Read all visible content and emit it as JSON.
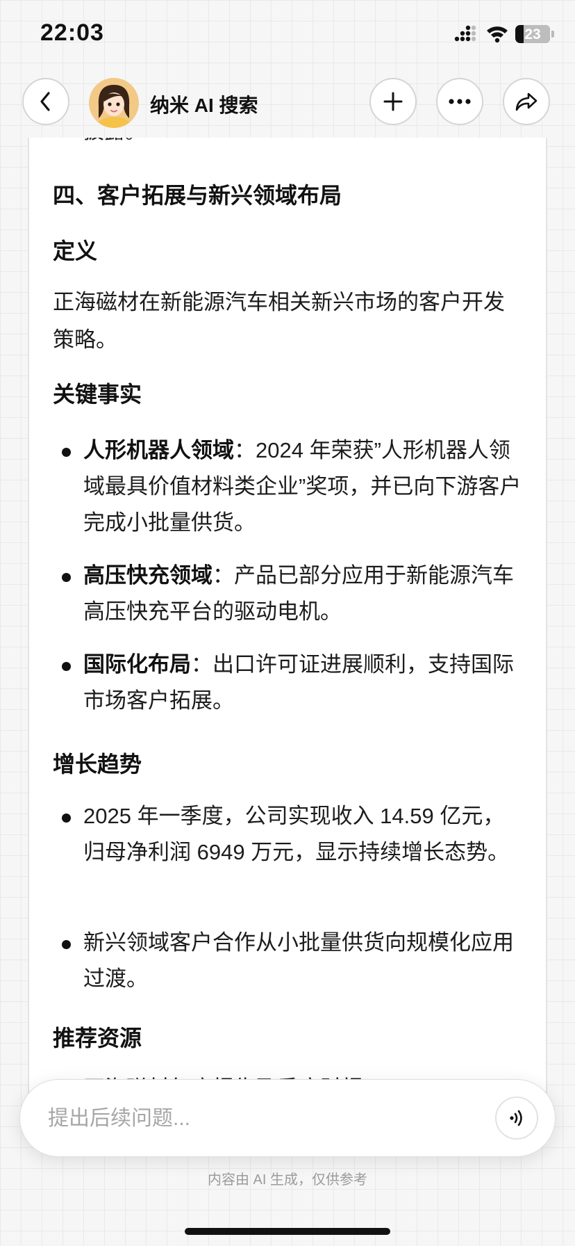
{
  "status_bar": {
    "time": "22:03",
    "battery_level": "23",
    "battery_fraction": 0.23
  },
  "header": {
    "agent_name": "纳米 AI 搜索",
    "back_icon": "chevron-left-icon",
    "new_icon": "plus-icon",
    "more_icon": "more-horizontal-icon",
    "share_icon": "share-icon"
  },
  "content": {
    "cut_text": "披露。",
    "section_title": "四、客户拓展与新兴领域布局",
    "definition_heading": "定义",
    "definition_text": "正海磁材在新能源汽车相关新兴市场的客户开发策略。",
    "facts_heading": "关键事实",
    "facts": [
      {
        "label": "人形机器人领域",
        "text": "：2024 年荣获”人形机器人领域最具价值材料类企业”奖项，并已向下游客户完成小批量供货。"
      },
      {
        "label": "高压快充领域",
        "text": "：产品已部分应用于新能源汽车高压快充平台的驱动电机。"
      },
      {
        "label": "国际化布局",
        "text": "：出口许可证进展顺利，支持国际市场客户拓展。"
      }
    ],
    "growth_heading": "增长趋势",
    "growth": [
      "2025 年一季度，公司实现收入 14.59 亿元，归母净利润 6949 万元，显示持续增长态势。",
      "新兴领域客户合作从小批量供货向规模化应用过渡。"
    ],
    "resources_heading": "推荐资源",
    "resources_cut": "正海磁材年度报告及季度财报"
  },
  "input": {
    "placeholder": "提出后续问题...",
    "voice_icon": "voice-icon"
  },
  "disclaimer": "内容由 AI 生成，仅供参考"
}
